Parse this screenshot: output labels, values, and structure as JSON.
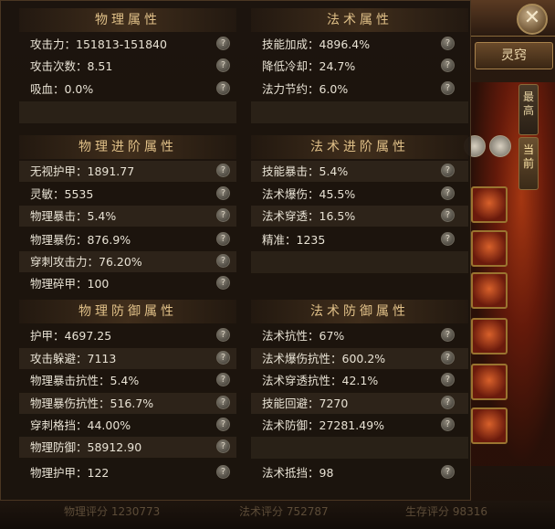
{
  "close_glyph": "✕",
  "right_panel": {
    "tab_lingqiao": "灵窍",
    "vtab_highest": "最高",
    "vtab_current": "当前"
  },
  "sections": {
    "physical": {
      "title": "物理属性",
      "rows": [
        {
          "label": "攻击力：151813-151840"
        },
        {
          "label": "攻击次数：8.51"
        },
        {
          "label": "吸血：0.0%"
        }
      ]
    },
    "magic": {
      "title": "法术属性",
      "rows": [
        {
          "label": "技能加成：4896.4%"
        },
        {
          "label": "降低冷却：24.7%"
        },
        {
          "label": "法力节约：6.0%"
        }
      ]
    },
    "physical_adv": {
      "title": "物理进阶属性",
      "rows": [
        {
          "label": "无视护甲：1891.77"
        },
        {
          "label": "灵敏：5535"
        },
        {
          "label": "物理暴击：5.4%"
        },
        {
          "label": "物理暴伤：876.9%"
        },
        {
          "label": "穿刺攻击力：76.20%"
        },
        {
          "label": "物理碎甲：100"
        }
      ]
    },
    "magic_adv": {
      "title": "法术进阶属性",
      "rows": [
        {
          "label": "技能暴击：5.4%"
        },
        {
          "label": "法术爆伤：45.5%"
        },
        {
          "label": "法术穿透：16.5%"
        },
        {
          "label": "精准：1235"
        }
      ]
    },
    "physical_def": {
      "title": "物理防御属性",
      "rows": [
        {
          "label": "护甲：4697.25"
        },
        {
          "label": "攻击躲避：7113"
        },
        {
          "label": "物理暴击抗性：5.4%"
        },
        {
          "label": "物理暴伤抗性：516.7%"
        },
        {
          "label": "穿刺格挡：44.00%"
        },
        {
          "label": "物理防御：58912.90"
        },
        {
          "label": "物理护甲：122"
        }
      ]
    },
    "magic_def": {
      "title": "法术防御属性",
      "rows": [
        {
          "label": "法术抗性：67%"
        },
        {
          "label": "法术爆伤抗性：600.2%"
        },
        {
          "label": "法术穿透抗性：42.1%"
        },
        {
          "label": "技能回避：7270"
        },
        {
          "label": "法术防御：27281.49%"
        },
        {
          "label": "法术抵挡：98"
        }
      ]
    }
  },
  "help_glyph": "?",
  "bottom_line": {
    "physical_score": "物理评分 1230773",
    "magic_score": "法术评分 752787",
    "survival_score": "生存评分 98316"
  }
}
